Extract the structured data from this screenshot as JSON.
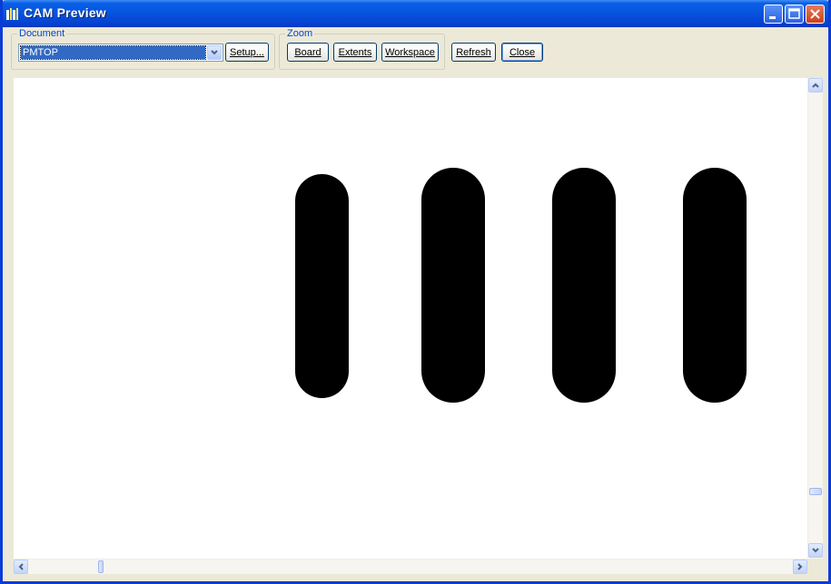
{
  "window": {
    "title": "CAM Preview"
  },
  "document_group": {
    "label": "Document",
    "selected": "PMTOP",
    "setup_label": "Setup..."
  },
  "zoom_group": {
    "label": "Zoom",
    "board_label": "Board",
    "extents_label": "Extents",
    "workspace_label": "Workspace"
  },
  "actions": {
    "refresh_label": "Refresh",
    "close_label": "Close"
  },
  "canvas": {
    "background": "#ffffff",
    "shape_color": "#000000",
    "shapes": [
      "pad-1",
      "pad-2",
      "pad-3",
      "pad-4"
    ]
  },
  "colors": {
    "titlebar": "#0653df",
    "group_label": "#0046d5",
    "selection": "#316ac5"
  },
  "icons": {
    "app": "cam-app-icon",
    "minimize": "minimize-icon",
    "maximize": "maximize-icon",
    "close": "close-icon",
    "dropdown": "chevron-down-icon",
    "scroll_up": "arrow-up-icon",
    "scroll_down": "arrow-down-icon",
    "scroll_left": "arrow-left-icon",
    "scroll_right": "arrow-right-icon"
  }
}
